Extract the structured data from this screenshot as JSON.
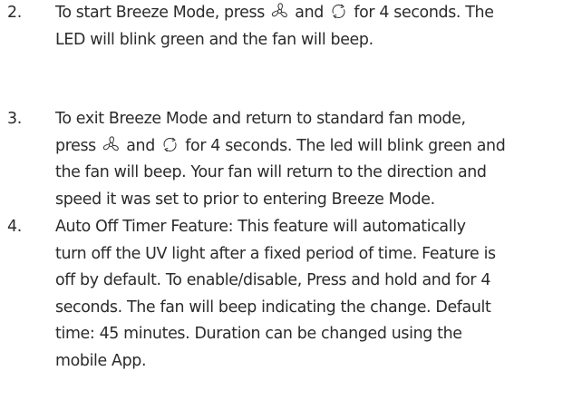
{
  "steps": [
    {
      "number": "2.",
      "lines": [
        [
          "To start Breeze Mode, press ",
          {
            "icon": "fan-icon"
          },
          " and ",
          {
            "icon": "reverse-icon"
          },
          " for 4 seconds. The"
        ],
        [
          "LED will blink green and the fan will beep."
        ]
      ]
    },
    {
      "number": "3.",
      "lines": [
        [
          "To exit Breeze Mode and return to standard fan mode,"
        ],
        [
          "press ",
          {
            "icon": "fan-icon"
          },
          " and ",
          {
            "icon": "reverse-icon"
          },
          " for 4 seconds. The led will blink green and"
        ],
        [
          "the fan will beep. Your fan will return to the direction and"
        ],
        [
          "speed it was set to prior to entering Breeze Mode."
        ]
      ]
    },
    {
      "number": "4.",
      "lines": [
        [
          "Auto Off Timer Feature: This feature will automatically"
        ],
        [
          "turn off the UV light after a fixed period of time. Feature is"
        ],
        [
          "off by default. To enable/disable, Press and hold and for 4"
        ],
        [
          "seconds. The fan will beep indicating the change. Default"
        ],
        [
          "time: 45 minutes. Duration can be changed using the"
        ],
        [
          "mobile App."
        ]
      ]
    }
  ]
}
